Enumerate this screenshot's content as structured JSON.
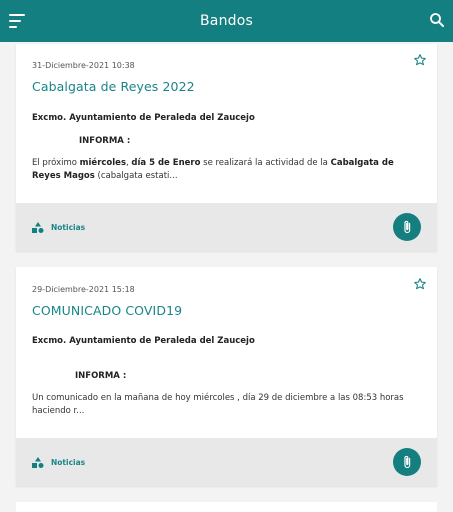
{
  "app_bar": {
    "title": "Bandos",
    "menu_icon": "menu-icon",
    "search_icon": "search-icon",
    "color": "#137f80"
  },
  "posts": [
    {
      "date": "31-Diciembre-2021 10:38",
      "title": "Cabalgata de Reyes 2022",
      "issuer": "Excmo. Ayuntamiento de Peraleda del Zaucejo",
      "informa": "INFORMA :",
      "excerpt_parts": [
        {
          "t": "El próximo ",
          "b": false
        },
        {
          "t": "miércoles",
          "b": true
        },
        {
          "t": ", ",
          "b": false
        },
        {
          "t": "día 5 de Enero",
          "b": true
        },
        {
          "t": " se realizará la actividad de la ",
          "b": false
        },
        {
          "t": "Cabalgata de Reyes Magos",
          "b": true
        },
        {
          "t": " (cabalgata estati...",
          "b": false
        }
      ],
      "category": "Noticias",
      "favorite_icon": "star-outline-icon",
      "attachment_icon": "paperclip-icon"
    },
    {
      "date": "29-Diciembre-2021 15:18",
      "title": "COMUNICADO COVID19",
      "issuer": "Excmo. Ayuntamiento de Peraleda del Zaucejo",
      "informa": "INFORMA :",
      "excerpt_parts": [
        {
          "t": " Un comunicado en la mañana de hoy miércoles , día 29 de diciembre a las 08:53 horas haciendo r...",
          "b": false
        }
      ],
      "category": "Noticias",
      "favorite_icon": "star-outline-icon",
      "attachment_icon": "paperclip-icon"
    }
  ]
}
